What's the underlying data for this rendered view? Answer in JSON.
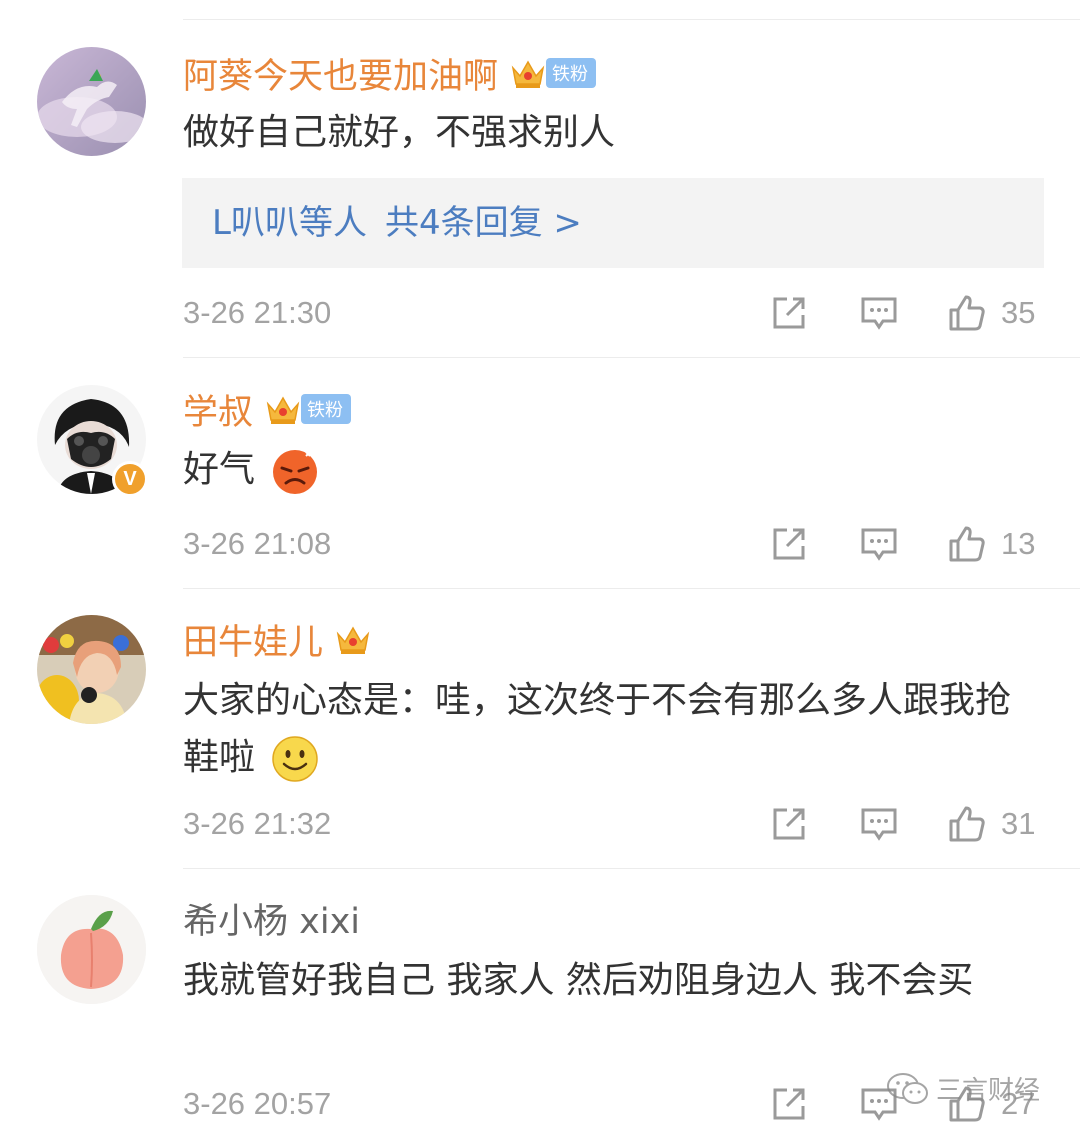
{
  "comments": [
    {
      "name": "阿葵今天也要加油啊",
      "badge": "铁粉",
      "text": "做好自己就好，不强求别人",
      "reply": {
        "names": "L叭叭等人",
        "count": "共4条回复 >"
      },
      "time": "3-26 21:30",
      "likes": "35",
      "avatar_icon": "cloud-horse-avatar"
    },
    {
      "name": "学叔",
      "badge": "铁粉",
      "text": "好气",
      "emoji": "angry-face-emoji",
      "verified": "V",
      "time": "3-26 21:08",
      "likes": "13",
      "avatar_icon": "gas-mask-avatar"
    },
    {
      "name": "田牛娃儿",
      "text": "大家的心态是：哇，这次终于不会有那么多人跟我抢鞋啦",
      "emoji": "smile-emoji",
      "time": "3-26 21:32",
      "likes": "31",
      "avatar_icon": "girl-avatar"
    },
    {
      "name": "希小杨 xixi",
      "text": "我就管好我自己 我家人 然后劝阻身边人 我不会买",
      "time": "3-26 20:57",
      "likes": "27",
      "avatar_icon": "peach-avatar"
    }
  ],
  "watermark": "三言财经",
  "colors": {
    "name": "#e8863a",
    "link": "#4c7dc0",
    "meta": "#a3a3a3",
    "badge": "#8dbff2"
  }
}
